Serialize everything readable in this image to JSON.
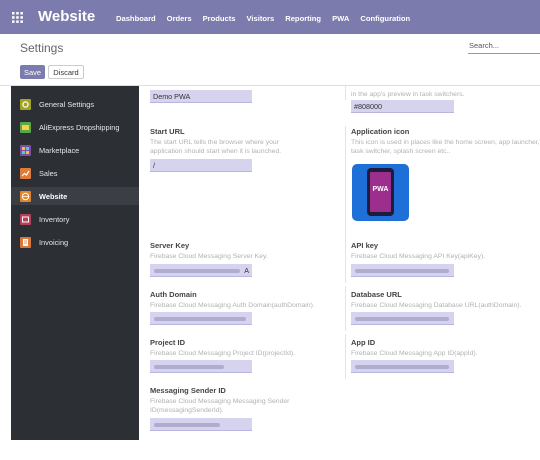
{
  "navbar": {
    "brand": "Website",
    "menu": [
      "Dashboard",
      "Orders",
      "Products",
      "Visitors",
      "Reporting",
      "PWA",
      "Configuration"
    ]
  },
  "control": {
    "title": "Settings",
    "search_placeholder": "Search...",
    "save_label": "Save",
    "discard_label": "Discard"
  },
  "sidebar": {
    "items": [
      {
        "label": "General Settings",
        "icon": "gear-icon",
        "color": "#a3a324"
      },
      {
        "label": "AliExpress Dropshipping",
        "icon": "aliexpress-icon",
        "color": "#59a84b"
      },
      {
        "label": "Marketplace",
        "icon": "marketplace-icon",
        "color": "#7d4fa0"
      },
      {
        "label": "Sales",
        "icon": "sales-icon",
        "color": "#e07b39"
      },
      {
        "label": "Website",
        "icon": "globe-icon",
        "color": "#e0842e"
      },
      {
        "label": "Inventory",
        "icon": "inventory-icon",
        "color": "#b3425a"
      },
      {
        "label": "Invoicing",
        "icon": "invoicing-icon",
        "color": "#d9783a"
      }
    ],
    "active": "Website"
  },
  "fields": {
    "short_name_value": "Demo PWA",
    "theme_desc": "in the app's preview in task switchers.",
    "theme_value": "#808000",
    "start_url": {
      "title": "Start URL",
      "desc": "The start URL tells the browser where your application should start when it is launched.",
      "value": "/"
    },
    "app_icon": {
      "title": "Application icon",
      "desc": "This icon is used in places like the home screen, app launcher, task switcher, splash screen etc..",
      "badge": "PWA"
    },
    "server_key": {
      "title": "Server Key",
      "desc": "Firebase Cloud Messaging Server Key.",
      "tail": "A"
    },
    "api_key": {
      "title": "API key",
      "desc": "Firebase Cloud Messaging API Key(apiKey)."
    },
    "auth_domain": {
      "title": "Auth Domain",
      "desc": "Firebase Cloud Messaging Auth Domain(authDomain)."
    },
    "database_url": {
      "title": "Database URL",
      "desc": "Firebase Cloud Messaging Database URL(authDomain)."
    },
    "project_id": {
      "title": "Project ID",
      "desc": "Firebase Cloud Messaging Project ID(projectId)."
    },
    "app_id": {
      "title": "App ID",
      "desc": "Firebase Cloud Messaging App ID(appId)."
    },
    "sender_id": {
      "title": "Messaging Sender ID",
      "desc": "Firebase Cloud Messaging Messaging Sender ID(messagingSenderId)."
    }
  }
}
